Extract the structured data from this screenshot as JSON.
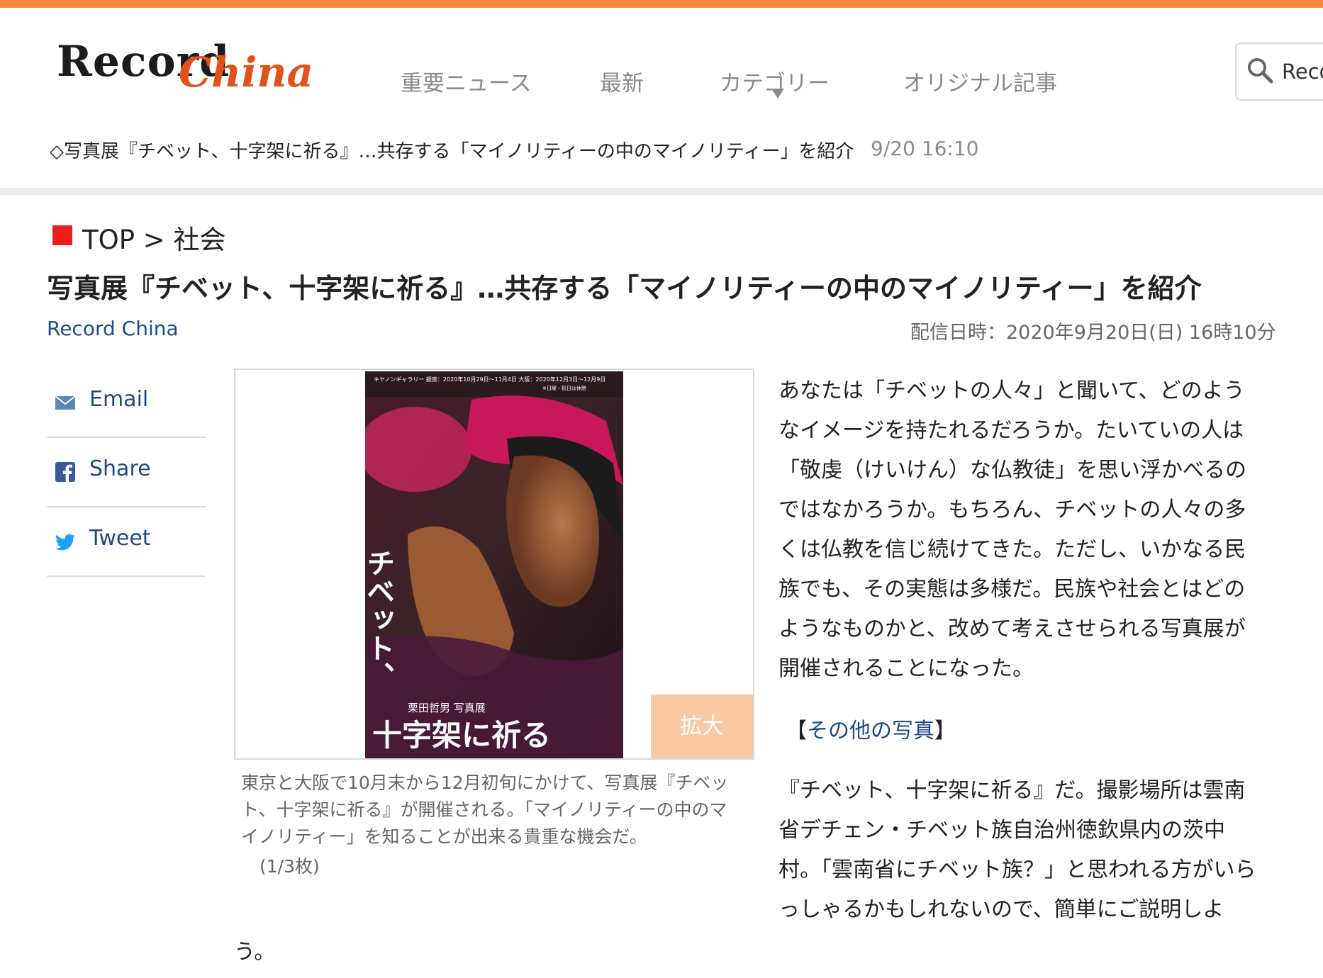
{
  "header": {
    "logo_text_1": "Record",
    "logo_text_2": "China",
    "nav": [
      "重要ニュース",
      "最新",
      "カテゴリー",
      "オリジナル記事"
    ],
    "search_text": "Reco",
    "ticker_text": "◇写真展『チベット、十字架に祈る』…共存する「マイノリティーの中のマイノリティー」を紹介",
    "ticker_time": "9/20 16:10"
  },
  "article": {
    "breadcrumb": "TOP > 社会",
    "title": "写真展『チベット、十字架に祈る』…共存する「マイノリティーの中のマイノリティー」を紹介",
    "source": "Record China",
    "dateline": "配信日時：2020年9月20日(日) 16時10分",
    "share": {
      "email": "Email",
      "facebook": "Share",
      "twitter": "Tweet"
    },
    "photo": {
      "poster_top_text": "キヤノンギャラリー 銀座：2020年10月29日〜11月4日 大阪：2020年12月3日〜12月9日",
      "poster_top_text2": "※日曜・祝日は休館",
      "poster_vertical": "チベット、",
      "poster_author": "栗田哲男 写真展",
      "poster_title": "十字架に祈る",
      "expand_label": "拡大",
      "caption": "東京と大阪で10月末から12月初旬にかけて、写真展『チベット、十字架に祈る』が開催される。「マイノリティーの中のマイノリティー」を知ることが出来る貴重な機会だ。",
      "count": "(1/3枚)"
    },
    "paragraph1": "あなたは「チベットの人々」と聞いて、どのようなイメージを持たれるだろうか。たいていの人は「敬虔（けいけん）な仏教徒」を思い浮かべるのではなかろうか。もちろん、チベットの人々の多くは仏教を信じ続けてきた。ただし、いかなる民族でも、その実態は多様だ。民族や社会とはどのようなものかと、改めて考えさせられる写真展が開催されることになった。",
    "more_photos_open": "【",
    "more_photos_link": "その他の写真",
    "more_photos_close": "】",
    "paragraph2": "『チベット、十字架に祈る』だ。撮影場所は雲南省デチェン・チベット族自治州徳欽県内の茨中村。「雲南省にチベット族？」と思われる方がいらっしゃるかもしれないので、簡単にご説明しよ",
    "tail_char": "う。"
  },
  "colors": {
    "accent_orange": "#f38a3c",
    "logo_orange": "#e0521c",
    "link_blue": "#1f4a8a",
    "breadcrumb_red": "#ee1c1c",
    "expand_bg": "#f8c9a2"
  }
}
